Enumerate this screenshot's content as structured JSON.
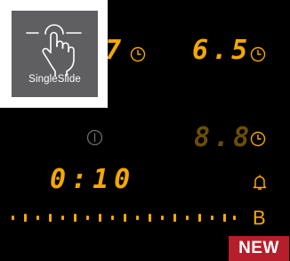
{
  "overlay": {
    "label": "SingleSlide",
    "icon": "hand-swipe-icon"
  },
  "zones": [
    {
      "id": "zone-1",
      "display": "7",
      "icon": "clock-icon"
    },
    {
      "id": "zone-2",
      "display": "6.5",
      "icon": "clock-icon"
    },
    {
      "id": "zone-3",
      "display": "8.8",
      "icon": "clock-icon"
    }
  ],
  "power": {
    "icon": "power-icon"
  },
  "timer": {
    "display": "0:10",
    "icon": "bell-icon"
  },
  "slider": {
    "icon": "power-level-slider",
    "label": "B"
  },
  "badge": {
    "text": "NEW"
  },
  "colors": {
    "accent": "#f5a800",
    "background": "#000000",
    "badge": "#b51e2a",
    "overlay": "#5f5f62"
  }
}
